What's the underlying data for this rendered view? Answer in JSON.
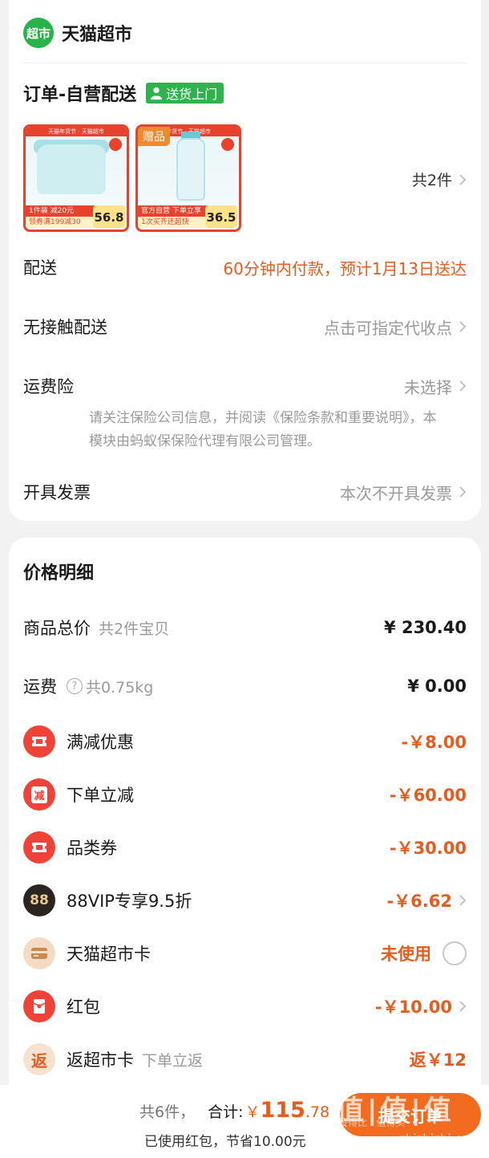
{
  "store": {
    "logo_text": "超市",
    "name": "天猫超市"
  },
  "order": {
    "title": "订单-自营配送",
    "badge": "送货上门",
    "products": [
      {
        "strip": "天猫年货节 · 天猫超市",
        "promo": "1件装 减20元",
        "promo2": "领券满199减30",
        "price": "56.8"
      },
      {
        "gift_tag": "赠品",
        "strip": "年货节 · 天猫超市",
        "promo": "官方自营 下单立享",
        "promo2": "1次买齐还超快",
        "price": "36.5"
      }
    ],
    "count": "共2件",
    "delivery": {
      "label": "配送",
      "value": "60分钟内付款，预计1月13日送达"
    },
    "contactless": {
      "label": "无接触配送",
      "value": "点击可指定代收点"
    },
    "insurance": {
      "label": "运费险",
      "value": "未选择",
      "note": "请关注保险公司信息，并阅读《保险条款和重要说明》，本模块由蚂蚁保保险代理有限公司管理。"
    },
    "invoice": {
      "label": "开具发票",
      "value": "本次不开具发票"
    }
  },
  "price": {
    "title": "价格明细",
    "goods_total": {
      "label": "商品总价",
      "sub": "共2件宝贝",
      "amount": "¥ 230.40"
    },
    "shipping": {
      "label": "运费",
      "help": "?",
      "weight": "共0.75kg",
      "amount": "¥ 0.00"
    },
    "discounts": [
      {
        "label": "满减优惠",
        "amount": "-￥8.00"
      },
      {
        "label": "下单立减",
        "icon_text": "减",
        "amount": "-￥60.00"
      },
      {
        "label": "品类券",
        "amount": "-￥30.00"
      },
      {
        "label": "88VIP专享9.5折",
        "icon_text": "88",
        "amount": "-￥6.62"
      },
      {
        "label": "天猫超市卡",
        "amount": "未使用"
      },
      {
        "label": "红包",
        "amount": "-￥10.00"
      },
      {
        "label": "返超市卡",
        "icon_text": "返",
        "sub": "下单立返",
        "amount": "返￥12"
      }
    ]
  },
  "bottom": {
    "count": "共6件，",
    "total_label": "合计:",
    "currency": "￥",
    "total_int": "115",
    "total_dec": ".78",
    "saved": "已使用红包，节省10.00元",
    "submit": "提交订单"
  },
  "watermark": {
    "main": "值|值|值",
    "sub": "zhizhizhi.com",
    "tag": "没得比 · 值得买"
  },
  "colors": {
    "accent": "#e85b1d",
    "green": "#27b34a",
    "red": "#f04236"
  }
}
